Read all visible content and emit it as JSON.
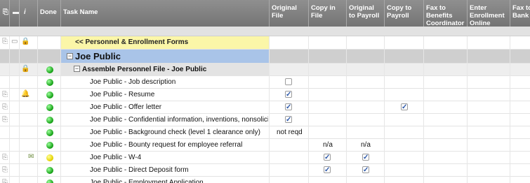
{
  "header": {
    "columns": {
      "attachments": "⎘",
      "comments": "▬",
      "info": "i",
      "done": "Done",
      "task_name": "Task Name",
      "original_file": "Original File",
      "copy_in_file": "Copy in File",
      "original_to_payroll": "Original to Payroll",
      "copy_to_payroll": "Copy to Payroll",
      "fax_benefits": "Fax to Benefits Coordinator",
      "enter_enrollment": "Enter Enrollment Online",
      "fax_bank": "Fax to Bank"
    }
  },
  "rows": [
    {
      "type": "link",
      "task": "<< Personnel & Enrollment Forms"
    },
    {
      "type": "section",
      "task": "Joe Public"
    },
    {
      "type": "group",
      "task": "Assemble Personnel File - Joe Public"
    },
    {
      "type": "task",
      "task": "Joe Public - Job description",
      "status": "green",
      "original_file": "unchecked"
    },
    {
      "type": "task",
      "task": "Joe Public - Resume",
      "status": "green",
      "original_file": "checked"
    },
    {
      "type": "task",
      "task": "Joe Public - Offer letter",
      "status": "green",
      "original_file": "checked",
      "copy_to_payroll": "checked"
    },
    {
      "type": "task",
      "task": "Joe Public - Confidential information, inventions, nonsolicita",
      "status": "green",
      "original_file": "checked"
    },
    {
      "type": "task",
      "task": "Joe Public - Background check (level 1 clearance only)",
      "status": "green",
      "original_file_text": "not reqd"
    },
    {
      "type": "task",
      "task": "Joe Public - Bounty request for employee referral",
      "status": "green",
      "copy_in_file_text": "n/a",
      "original_to_payroll_text": "n/a"
    },
    {
      "type": "task",
      "task": "Joe Public - W-4",
      "status": "yellow",
      "copy_in_file": "checked",
      "original_to_payroll": "checked"
    },
    {
      "type": "task",
      "task": "Joe Public - Direct Deposit form",
      "status": "green",
      "copy_in_file": "checked",
      "original_to_payroll": "checked"
    },
    {
      "type": "task",
      "task": "Joe Public - Employment Application",
      "status": "green"
    }
  ],
  "icons": {
    "paperclip": "⎘",
    "comment": "▭",
    "lock": "🔒",
    "bell": "🔔",
    "note": "✉",
    "check": "✓",
    "minus": "−"
  },
  "colors": {
    "header_bg": "#7f7f7f",
    "link_row_bg": "#fbf6a8",
    "section_bg": "#a9c4e8",
    "group_bg": "#e3e3e3",
    "checkbox_check": "#2a56a8"
  }
}
